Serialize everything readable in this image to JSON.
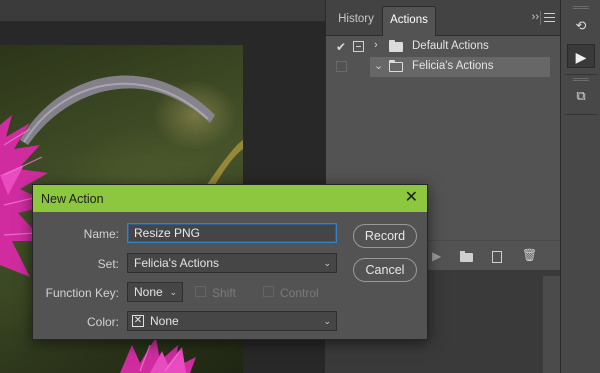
{
  "panel": {
    "tabs": [
      {
        "label": "History"
      },
      {
        "label": "Actions"
      }
    ],
    "collapse_glyph": "››",
    "action_sets": [
      {
        "label": "Default Actions",
        "checked": true,
        "expanded": false
      },
      {
        "label": "Felicia's Actions",
        "checked": false,
        "expanded": true,
        "selected": true
      }
    ],
    "footer_icons": [
      "play-icon",
      "folder-icon",
      "new-action-icon",
      "trash-icon"
    ]
  },
  "dialog": {
    "title": "New Action",
    "close_glyph": "✕",
    "name_label": "Name:",
    "name_value": "Resize PNG",
    "set_label": "Set:",
    "set_value": "Felicia's Actions",
    "function_key_label": "Function Key:",
    "function_key_value": "None",
    "shift_label": "Shift",
    "control_label": "Control",
    "color_label": "Color:",
    "color_value": "None",
    "record_label": "Record",
    "cancel_label": "Cancel"
  },
  "colors": {
    "dialog_titlebar": "#8dc63f",
    "panel_bg": "#535353",
    "focus_border": "#3a7fc4",
    "flower": "#d02ca0"
  }
}
